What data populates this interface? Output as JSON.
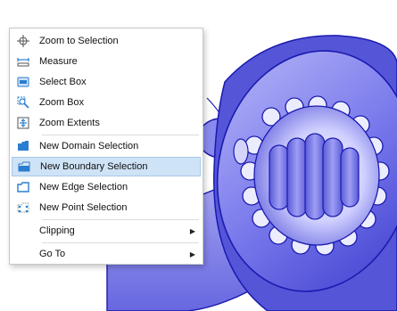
{
  "context_menu": {
    "items": [
      {
        "label": "Zoom to Selection",
        "icon": "zoom-to-selection-icon"
      },
      {
        "label": "Measure",
        "icon": "measure-icon"
      },
      {
        "label": "Select Box",
        "icon": "select-box-icon"
      },
      {
        "label": "Zoom Box",
        "icon": "zoom-box-icon"
      },
      {
        "label": "Zoom Extents",
        "icon": "zoom-extents-icon"
      },
      {
        "label": "New Domain Selection",
        "icon": "domain-selection-icon"
      },
      {
        "label": "New Boundary Selection",
        "icon": "boundary-selection-icon",
        "highlighted": true
      },
      {
        "label": "New Edge Selection",
        "icon": "edge-selection-icon"
      },
      {
        "label": "New Point Selection",
        "icon": "point-selection-icon"
      },
      {
        "label": "Clipping",
        "submenu": true
      },
      {
        "label": "Go To",
        "submenu": true
      }
    ]
  },
  "colors": {
    "model_fill": "#6a6ae6",
    "model_edge": "#1a1ab0",
    "highlight": "#cfe3f6",
    "icon_blue": "#2a7ed0"
  }
}
